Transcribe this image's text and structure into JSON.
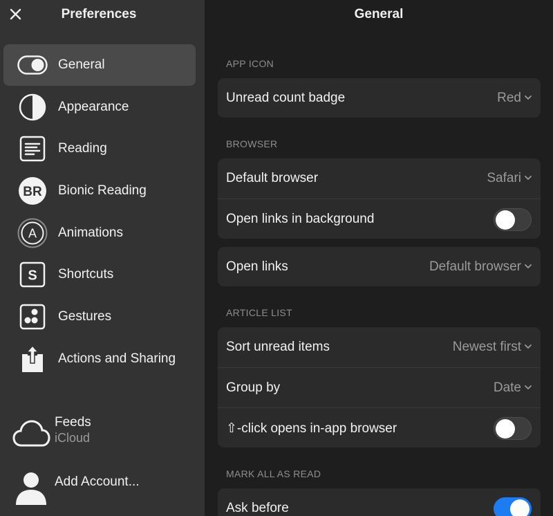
{
  "sidebar": {
    "title": "Preferences",
    "items": [
      {
        "label": "General",
        "icon": "toggle-icon",
        "selected": true
      },
      {
        "label": "Appearance",
        "icon": "half-circle-icon"
      },
      {
        "label": "Reading",
        "icon": "text-lines-icon"
      },
      {
        "label": "Bionic Reading",
        "icon": "br-badge-icon",
        "badge": "BR"
      },
      {
        "label": "Animations",
        "icon": "animation-a-icon",
        "badge": "A"
      },
      {
        "label": "Shortcuts",
        "icon": "shortcut-s-icon",
        "badge": "S"
      },
      {
        "label": "Gestures",
        "icon": "gestures-icon"
      },
      {
        "label": "Actions and Sharing",
        "icon": "share-icon"
      }
    ],
    "accounts": {
      "feeds_label": "Feeds",
      "feeds_sub": "iCloud",
      "add_label": "Add Account..."
    }
  },
  "main": {
    "title": "General",
    "sections": {
      "app_icon": {
        "label": "APP ICON",
        "rows": [
          {
            "label": "Unread count badge",
            "value": "Red"
          }
        ]
      },
      "browser": {
        "label": "BROWSER",
        "rows": [
          {
            "label": "Default browser",
            "value": "Safari"
          },
          {
            "label": "Open links in background",
            "toggle": false
          },
          {
            "label": "Open links",
            "value": "Default browser"
          }
        ]
      },
      "article_list": {
        "label": "ARTICLE LIST",
        "rows": [
          {
            "label": "Sort unread items",
            "value": "Newest first"
          },
          {
            "label": "Group by",
            "value": "Date"
          },
          {
            "label": "⇧-click opens in-app browser",
            "toggle": false
          }
        ]
      },
      "mark_all": {
        "label": "MARK ALL AS READ",
        "rows": [
          {
            "label": "Ask before",
            "toggle": true
          }
        ]
      }
    }
  },
  "colors": {
    "sidebar_bg": "#333333",
    "main_bg": "#1e1e1e",
    "group_bg": "#2b2b2b",
    "accent": "#1e7cf2"
  }
}
